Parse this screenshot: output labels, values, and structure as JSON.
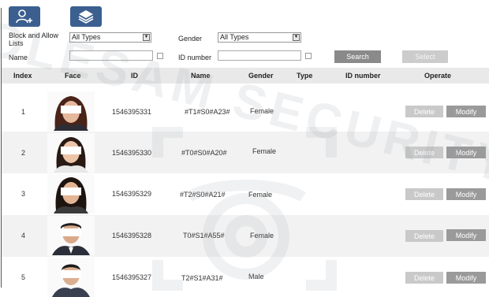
{
  "toolbar": {
    "add_icon": "add-user-icon",
    "layers_icon": "layers-icon"
  },
  "filters": {
    "list_label": "Block and Allow Lists",
    "list_value": "All Types",
    "gender_label": "Gender",
    "gender_value": "All Types",
    "name_label": "Name",
    "name_value": "",
    "id_number_label": "ID number",
    "id_number_value": "",
    "search_label": "Search",
    "select_label": "Select"
  },
  "table": {
    "headers": [
      "Index",
      "Face",
      "ID",
      "Name",
      "Gender",
      "Type",
      "ID number",
      "Operate"
    ],
    "delete_label": "Delete",
    "modify_label": "Modify",
    "rows": [
      {
        "index": "1",
        "id": "1546395331",
        "name": "#T1#S0#A23#",
        "gender": "Female",
        "type": "",
        "id_number": ""
      },
      {
        "index": "2",
        "id": "1546395330",
        "name": "#T0#S0#A20#",
        "gender": "Female",
        "type": "",
        "id_number": ""
      },
      {
        "index": "3",
        "id": "1546395329",
        "name": "#T2#S0#A21#",
        "gender": "Female",
        "type": "",
        "id_number": ""
      },
      {
        "index": "4",
        "id": "1546395328",
        "name": "T0#S1#A55#",
        "gender": "Female",
        "type": "",
        "id_number": ""
      },
      {
        "index": "5",
        "id": "1546395327",
        "name": "T2#S1#A31#",
        "gender": "Male",
        "type": "",
        "id_number": ""
      }
    ]
  },
  "watermark": "OLESAM SECURITY",
  "colors": {
    "icon_button": "#3b5f8f",
    "header_bg": "#e9e9e9",
    "search_button": "#8a8a8a",
    "select_button": "#cccccc",
    "delete_button": "#c9c9c9",
    "modify_button": "#9a9a9a"
  }
}
